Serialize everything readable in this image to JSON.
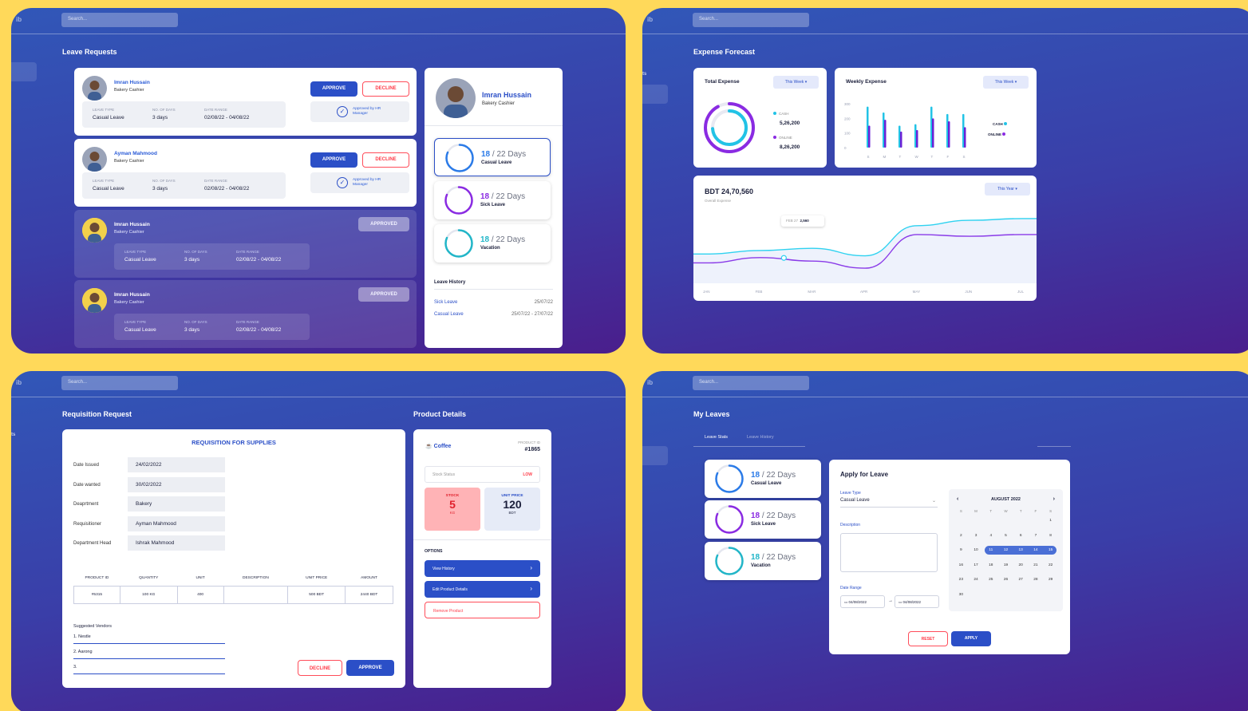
{
  "colors": {
    "background": "#FFD95A",
    "primary": "#2b4fc7",
    "danger": "#ff3b48",
    "cyan": "#22c3e6",
    "purple": "#8a2be2"
  },
  "search": {
    "placeholder": "Search..."
  },
  "leave_requests": {
    "title": "Leave Requests",
    "columns": {
      "type": "LEAVE TYPE",
      "days": "NO. OF DAYS",
      "range": "DATE RANGE"
    },
    "approve_label": "APPROVE",
    "decline_label": "DECLINE",
    "approved_label": "APPROVED",
    "approved_by": "Approved by HR Manager",
    "requests": [
      {
        "name": "Imran Hussain",
        "role": "Bakery Cashier",
        "type": "Casual Leave",
        "days": "3 days",
        "range": "02/08/22  -  04/08/22"
      },
      {
        "name": "Ayman Mahmood",
        "role": "Bakery Cashier",
        "type": "Casual Leave",
        "days": "3 days",
        "range": "02/08/22  -  04/08/22"
      },
      {
        "name": "Imran Hussain",
        "role": "Bakery Cashier",
        "type": "Casual Leave",
        "days": "3 days",
        "range": "02/08/22  -  04/08/22"
      },
      {
        "name": "Imran Hussain",
        "role": "Bakery Cashier",
        "type": "Casual Leave",
        "days": "3 days",
        "range": "02/08/22  -  04/08/22"
      }
    ],
    "profile": {
      "name": "Imran Hussain",
      "role": "Bakery Cashier",
      "stats": [
        {
          "count": "18",
          "total": "/ 22 Days",
          "label": "Casual Leave"
        },
        {
          "count": "18",
          "total": "/ 22 Days",
          "label": "Sick Leave"
        },
        {
          "count": "18",
          "total": "/ 22 Days",
          "label": "Vacation"
        }
      ],
      "history_title": "Leave History",
      "history": [
        {
          "type": "Sick Leave",
          "date": "25/07/22"
        },
        {
          "type": "Casual Leave",
          "date": "25/07/22  -  27/07/22"
        }
      ]
    }
  },
  "expense": {
    "title": "Expense Forecast",
    "total": {
      "title": "Total Expense",
      "filter": "This Week",
      "cash_label": "CASH",
      "cash_value": "5,26,200",
      "online_label": "ONLINE",
      "online_value": "8,26,200"
    },
    "weekly": {
      "title": "Weekly Expense",
      "filter": "This Week",
      "legend_cash": "CASH",
      "legend_online": "ONLINE"
    },
    "overall": {
      "value": "BDT  24,70,560",
      "subtitle": "Overall Expense",
      "filter": "This Year",
      "tooltip_date": "FEB 27",
      "tooltip_value": "2,560"
    }
  },
  "chart_data": [
    {
      "type": "bar",
      "title": "Weekly Expense",
      "categories": [
        "S",
        "M",
        "T",
        "W",
        "T",
        "F",
        "S"
      ],
      "ylim": [
        0,
        300
      ],
      "yticks": [
        "300",
        "200",
        "100",
        "0"
      ],
      "series": [
        {
          "name": "CASH",
          "values": [
            280,
            240,
            150,
            160,
            280,
            230,
            230
          ]
        },
        {
          "name": "ONLINE",
          "values": [
            150,
            190,
            110,
            120,
            200,
            180,
            140
          ]
        }
      ]
    },
    {
      "type": "line",
      "categories": [
        "JAN",
        "FEB",
        "MAR",
        "APR",
        "MAY",
        "JUN",
        "JUL"
      ],
      "series": [
        {
          "name": "",
          "values": [
            2400,
            2500,
            2560,
            2350,
            3200,
            3350,
            3400
          ]
        },
        {
          "name": "",
          "values": [
            2150,
            2300,
            2200,
            2000,
            2950,
            2900,
            2950
          ]
        }
      ]
    },
    {
      "type": "pie",
      "title": "Total Expense",
      "labels": [
        "CASH",
        "ONLINE"
      ],
      "values": [
        526200,
        826200
      ]
    }
  ],
  "requisition": {
    "title": "Requisition Request",
    "form_title": "REQUISITION FOR SUPPLIES",
    "fields": [
      {
        "label": "Date Issued",
        "value": "24/02/2022"
      },
      {
        "label": "Date wanted",
        "value": "30/02/2022"
      },
      {
        "label": "Deaprtment",
        "value": "Bakery"
      },
      {
        "label": "Requisitioner",
        "value": "Ayman Mahmood"
      },
      {
        "label": "Department Head",
        "value": "Ishrak Mahmood"
      }
    ],
    "table_headers": [
      "PRODUCT ID",
      "QUANTITY",
      "UNIT",
      "DESCRIPTION",
      "UNIT PRICE",
      "AMOUNT"
    ],
    "table_row": [
      "#5315",
      "100 KG",
      "400",
      "",
      "500 BDT",
      "2440 BDT"
    ],
    "vendors_title": "Suggested Vendors",
    "vendors": [
      "1.  Nestle",
      "2.  Aarong",
      "3."
    ],
    "decline_label": "DECLINE",
    "approve_label": "APPROVE"
  },
  "product": {
    "title": "Product Details",
    "name": "Coffee",
    "id_label": "PRODUCT ID",
    "id_value": "#1865",
    "stock_status_label": "Stock Status",
    "stock_status_value": "LOW",
    "stock_label": "STOCK",
    "stock_value": "5",
    "stock_unit": "KG",
    "price_label": "UNIT PRICE",
    "price_value": "120",
    "price_unit": "BDT",
    "options_title": "OPTIONS",
    "options": [
      "View History",
      "Edit Product Details",
      "Remove Product"
    ]
  },
  "my_leaves": {
    "title": "My Leaves",
    "tabs": [
      "Leave Stats",
      "Leave History"
    ],
    "stats": [
      {
        "count": "18",
        "total": "/ 22 Days",
        "label": "Casual Leave"
      },
      {
        "count": "18",
        "total": "/ 22 Days",
        "label": "Sick Leave"
      },
      {
        "count": "18",
        "total": "/ 22 Days",
        "label": "Vacation"
      }
    ],
    "apply": {
      "title": "Apply for Leave",
      "type_label": "Leave Type",
      "type_value": "Casual Leave",
      "desc_label": "Description",
      "range_label": "Date Range",
      "from": "04/08/2022",
      "arrow": "→",
      "to": "04/08/2022",
      "reset_label": "RESET",
      "apply_label": "APPLY"
    },
    "calendar": {
      "month": "AUGUST 2022",
      "weekdays": [
        "S",
        "M",
        "T",
        "W",
        "T",
        "F",
        "S"
      ],
      "days": [
        "",
        "",
        "",
        "",
        "",
        "",
        "1",
        "2",
        "3",
        "4",
        "5",
        "6",
        "7",
        "8",
        "9",
        "10",
        "11",
        "12",
        "13",
        "14",
        "15",
        "16",
        "17",
        "18",
        "19",
        "20",
        "21",
        "22",
        "23",
        "24",
        "25",
        "26",
        "27",
        "28",
        "29",
        "30"
      ]
    }
  }
}
